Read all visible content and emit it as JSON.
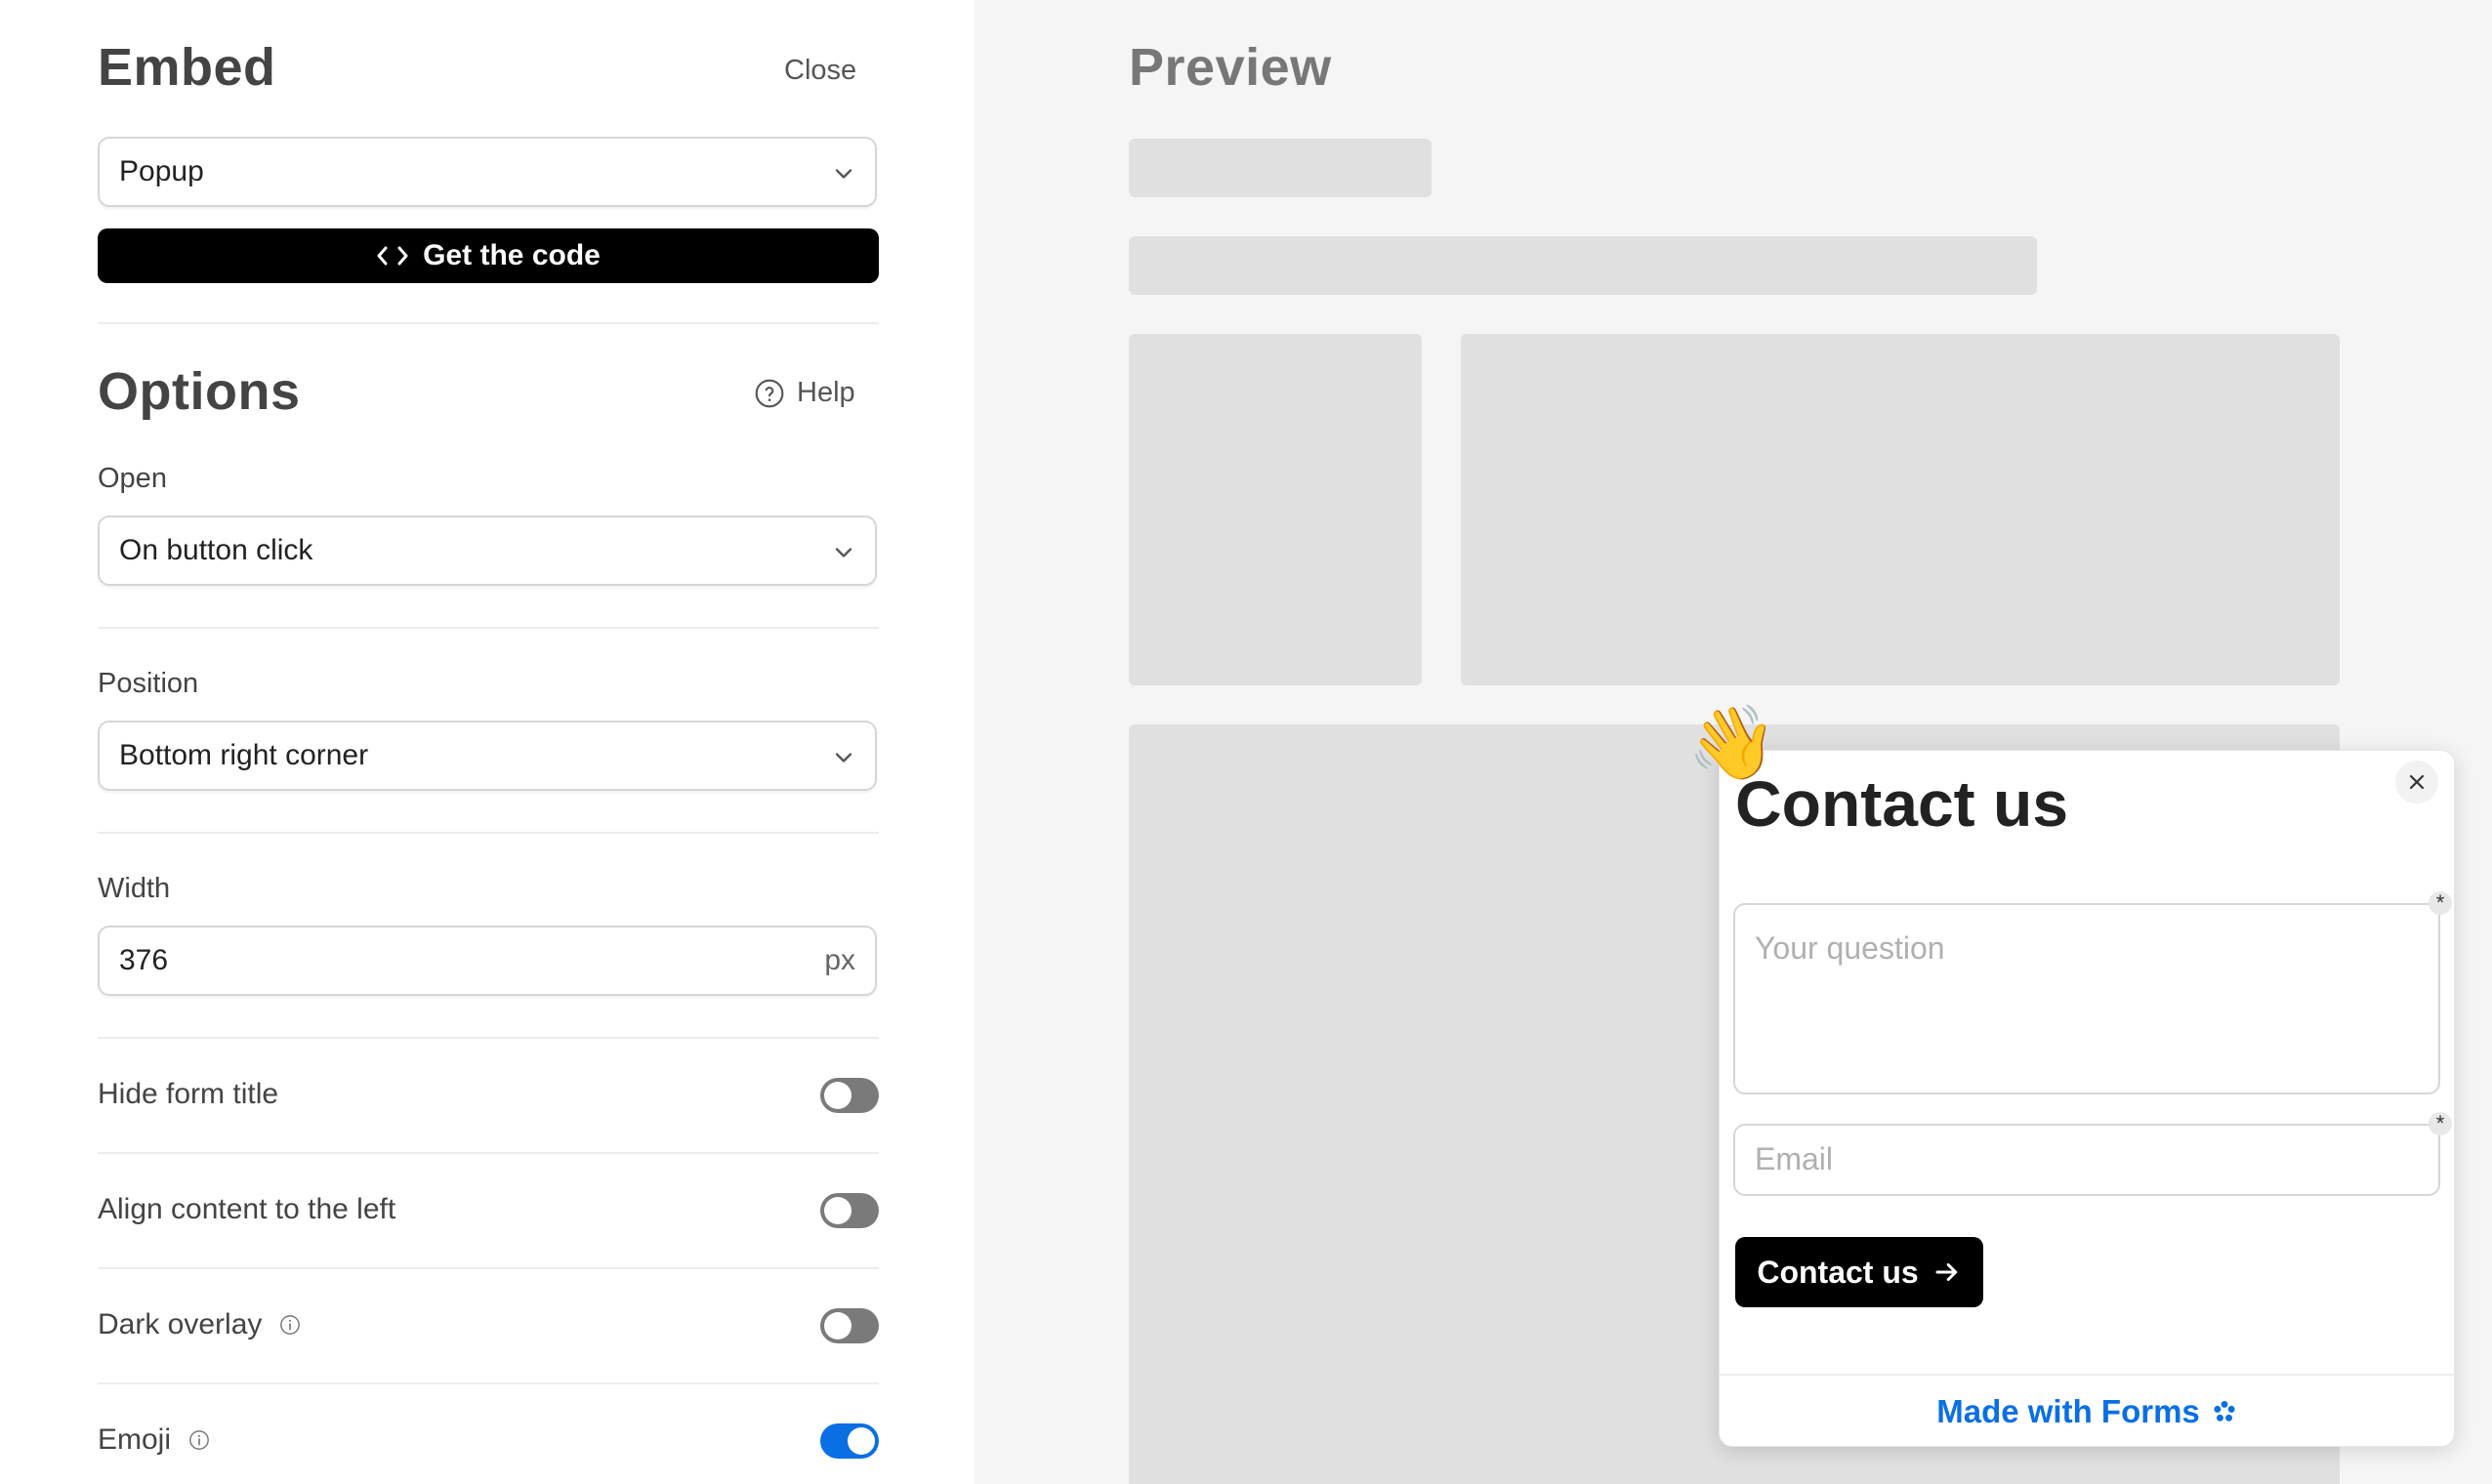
{
  "embed": {
    "title": "Embed",
    "close_label": "Close",
    "type_select": {
      "value": "Popup"
    },
    "get_code_label": "Get the code"
  },
  "options": {
    "title": "Options",
    "help_label": "Help",
    "open": {
      "label": "Open",
      "value": "On button click"
    },
    "position": {
      "label": "Position",
      "value": "Bottom right corner"
    },
    "width": {
      "label": "Width",
      "value": "376",
      "unit": "px"
    },
    "toggles": [
      {
        "label": "Hide form title",
        "on": false
      },
      {
        "label": "Align content to the left",
        "on": false
      },
      {
        "label": "Dark overlay",
        "on": false
      },
      {
        "label": "Emoji",
        "on": true
      }
    ]
  },
  "preview": {
    "title": "Preview",
    "popup": {
      "emoji": "👋",
      "title": "Contact us",
      "question_placeholder": "Your question",
      "email_placeholder": "Email",
      "required_mark": "*",
      "submit_label": "Contact us",
      "footer_label": "Made with Forms"
    }
  },
  "colors": {
    "accent": "#0a6fe3",
    "toggle_off": "#7a7a7a",
    "black": "#000000"
  }
}
